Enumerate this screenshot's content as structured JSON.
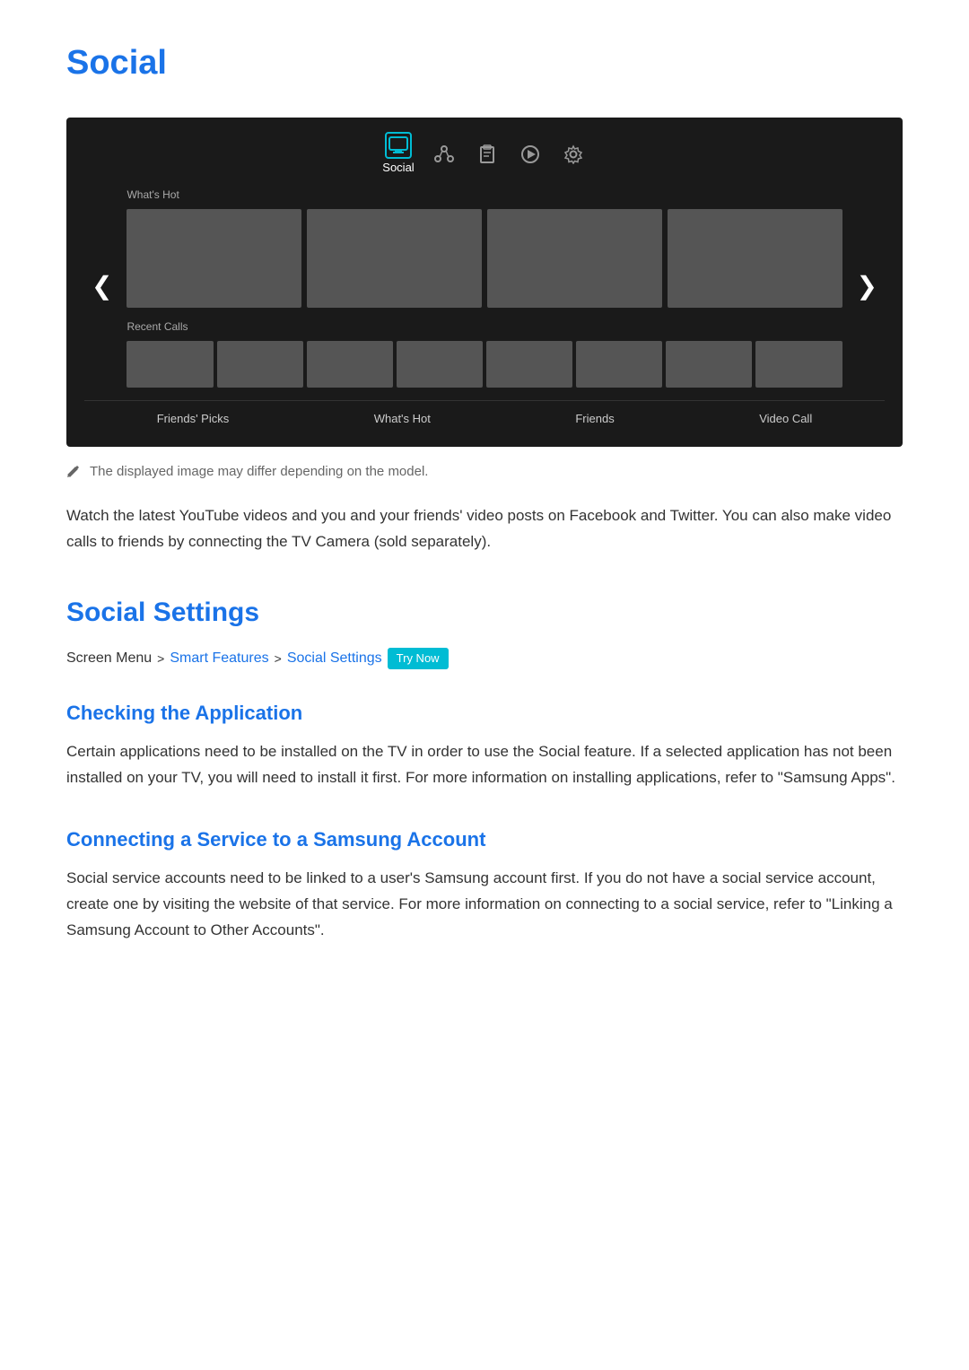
{
  "page": {
    "title": "Social",
    "description": "Watch the latest YouTube videos and you and your friends' video posts on Facebook and Twitter. You can also make video calls to friends by connecting the TV Camera (sold separately).",
    "note": "The displayed image may differ depending on the model."
  },
  "tv_ui": {
    "active_nav_label": "Social",
    "nav_icons": [
      "monitor",
      "share",
      "clipboard",
      "play",
      "settings"
    ],
    "section_whats_hot": "What's Hot",
    "section_recent_calls": "Recent Calls",
    "bottom_nav": [
      "Friends' Picks",
      "What's Hot",
      "Friends",
      "Video Call"
    ]
  },
  "social_settings_section": {
    "title": "Social Settings",
    "breadcrumb": {
      "prefix": "Screen Menu",
      "separator1": ">",
      "link1": "Smart Features",
      "separator2": ">",
      "link2": "Social Settings",
      "badge": "Try Now"
    }
  },
  "checking_application": {
    "title": "Checking the Application",
    "text": "Certain applications need to be installed on the TV in order to use the Social feature. If a selected application has not been installed on your TV, you will need to install it first. For more information on installing applications, refer to \"Samsung Apps\"."
  },
  "connecting_service": {
    "title": "Connecting a Service to a Samsung Account",
    "text": "Social service accounts need to be linked to a user's Samsung account first. If you do not have a social service account, create one by visiting the website of that service. For more information on connecting to a social service, refer to \"Linking a Samsung Account to Other Accounts\"."
  }
}
